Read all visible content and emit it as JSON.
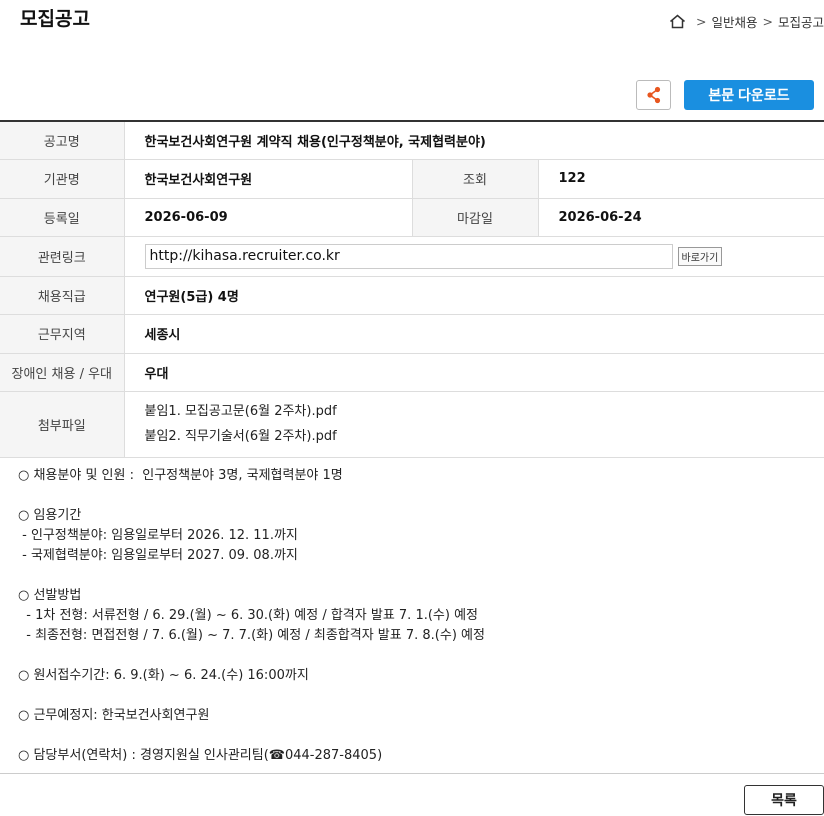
{
  "page": {
    "title": "모집공고"
  },
  "breadcrumb": {
    "home_icon": "home-icon",
    "items": [
      "일반채용",
      "모집공고"
    ],
    "separator": ">"
  },
  "toolbar": {
    "share_icon": "share-icon",
    "download_label": "본문 다운로드"
  },
  "info": {
    "title_label": "공고명",
    "title_value": "한국보건사회연구원 계약직 채용(인구정책분야, 국제협력분야)",
    "org_label": "기관명",
    "org_value": "한국보건사회연구원",
    "views_label": "조회",
    "views_value": "122",
    "reg_label": "등록일",
    "reg_value": "2026-06-09",
    "deadline_label": "마감일",
    "deadline_value": "2026-06-24",
    "link_label": "관련링크",
    "link_value": "http://kihasa.recruiter.co.kr",
    "link_button": "바로가기",
    "position_label": "채용직급",
    "position_value": "연구원(5급) 4명",
    "region_label": "근무지역",
    "region_value": "세종시",
    "disabled_label": "장애인 채용 / 우대",
    "disabled_value": "우대",
    "attach_label": "첨부파일",
    "attachments": [
      "붙임1. 모집공고문(6월 2주차).pdf",
      "붙임2. 직무기술서(6월 2주차).pdf"
    ]
  },
  "body": {
    "fields": "○ 채용분야 및 인원 :  인구정책분야 3명, 국제협력분야 1명",
    "period_title": "○ 임용기간",
    "period_1": " - 인구정책분야: 임용일로부터 2026. 12. 11.까지",
    "period_2": " - 국제협력분야: 임용일로부터 2027. 09. 08.까지",
    "selection_title": "○ 선발방법",
    "selection_1": "  - 1차 전형: 서류전형 / 6. 29.(월) ~ 6. 30.(화) 예정 / 합격자 발표 7. 1.(수) 예정",
    "selection_2": "  - 최종전형: 면접전형 / 7. 6.(월) ~ 7. 7.(화) 예정 / 최종합격자 발표 7. 8.(수) 예정",
    "apply_period": "○ 원서접수기간: 6. 9.(화) ~ 6. 24.(수) 16:00까지",
    "work_place": "○ 근무예정지: 한국보건사회연구원",
    "contact": "○ 담당부서(연락처) : 경영지원실 인사관리팀(☎044-287-8405)"
  },
  "footer": {
    "list_label": "목록"
  }
}
